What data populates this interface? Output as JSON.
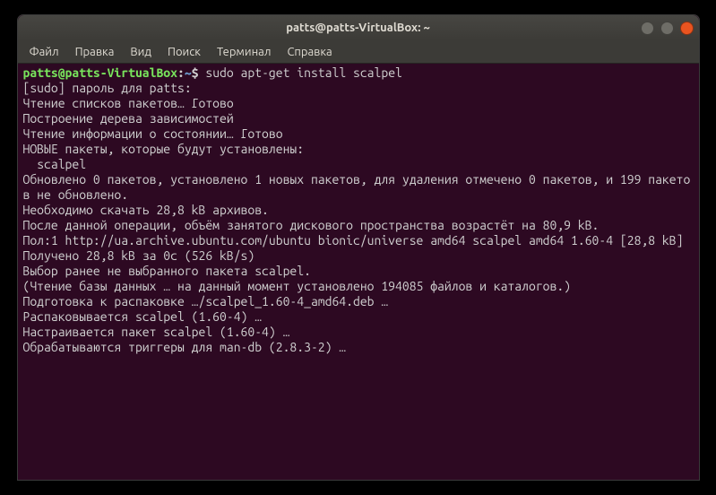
{
  "window": {
    "title": "patts@patts-VirtualBox: ~"
  },
  "menu": {
    "file": "Файл",
    "edit": "Правка",
    "view": "Вид",
    "search": "Поиск",
    "terminal": "Терминал",
    "help": "Справка"
  },
  "prompt": {
    "user": "patts@patts-VirtualBox",
    "colon": ":",
    "path": "~",
    "dollar": "$"
  },
  "command": "sudo apt-get install scalpel",
  "output": {
    "l1": "[sudo] пароль для patts:",
    "l2": "Чтение списков пакетов… Готово",
    "l3": "Построение дерева зависимостей",
    "l4": "Чтение информации о состоянии… Готово",
    "l5": "НОВЫЕ пакеты, которые будут установлены:",
    "l6": "  scalpel",
    "l7": "Обновлено 0 пакетов, установлено 1 новых пакетов, для удаления отмечено 0 пакетов, и 199 пакетов не обновлено.",
    "l8": "Необходимо скачать 28,8 kB архивов.",
    "l9": "После данной операции, объём занятого дискового пространства возрастёт на 80,9 kB.",
    "l10": "Пол:1 http://ua.archive.ubuntu.com/ubuntu bionic/universe amd64 scalpel amd64 1.60-4 [28,8 kB]",
    "l11": "Получено 28,8 kB за 0с (526 kB/s)",
    "l12": "Выбор ранее не выбранного пакета scalpel.",
    "l13": "(Чтение базы данных … на данный момент установлено 194085 файлов и каталогов.)",
    "l14": "Подготовка к распаковке …/scalpel_1.60-4_amd64.deb …",
    "l15": "Распаковывается scalpel (1.60-4) …",
    "l16": "Настраивается пакет scalpel (1.60-4) …",
    "l17": "Обрабатываются триггеры для man-db (2.8.3-2) …"
  }
}
